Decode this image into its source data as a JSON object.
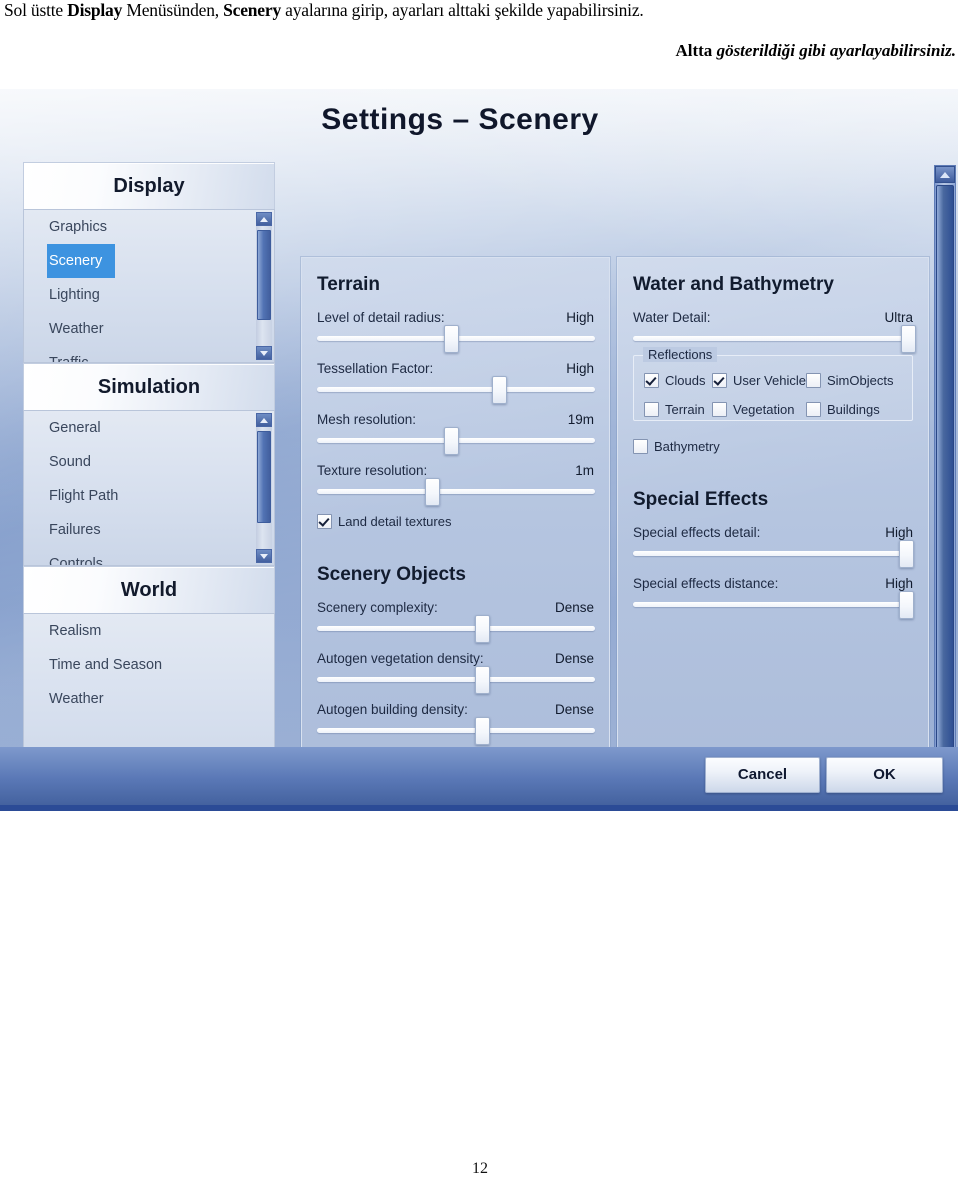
{
  "document": {
    "line1_pre": "Sol üstte ",
    "line1_b1": "Display",
    "line1_mid": " Menüsünden, ",
    "line1_b2": "Scenery",
    "line1_post": " ayalarına girip, ayarları alttaki şekilde yapabilirsiniz.",
    "line2_bold": "Altta ",
    "line2_bolditalic": "gösterildiği gibi ayarlayabilirsiniz.",
    "page_number": "12"
  },
  "dialog": {
    "title": "Settings – Scenery",
    "accent_color": "#3d93e0",
    "footer": {
      "cancel_label": "Cancel",
      "ok_label": "OK"
    }
  },
  "nav": {
    "groups": [
      {
        "header": "Display",
        "items": [
          "Graphics",
          "Scenery",
          "Lighting",
          "Weather",
          "Traffic"
        ],
        "selected": "Scenery",
        "scrollbar": true
      },
      {
        "header": "Simulation",
        "items": [
          "General",
          "Sound",
          "Flight Path",
          "Failures",
          "Controls"
        ],
        "selected": null,
        "scrollbar": true
      },
      {
        "header": "World",
        "items": [
          "Realism",
          "Time and Season",
          "Weather"
        ],
        "selected": null,
        "scrollbar": false
      }
    ]
  },
  "center_panel": {
    "groups": [
      {
        "title": "Terrain",
        "sliders": [
          {
            "label": "Level of detail radius:",
            "value": "High",
            "position_pct": 48
          },
          {
            "label": "Tessellation Factor:",
            "value": "High",
            "position_pct": 65
          },
          {
            "label": "Mesh resolution:",
            "value": "19m",
            "position_pct": 48
          },
          {
            "label": "Texture resolution:",
            "value": "1m",
            "position_pct": 41
          }
        ],
        "checkboxes": [
          {
            "label": "Land detail textures",
            "checked": true
          }
        ]
      },
      {
        "title": "Scenery Objects",
        "sliders": [
          {
            "label": "Scenery complexity:",
            "value": "Dense",
            "position_pct": 59
          },
          {
            "label": "Autogen vegetation density:",
            "value": "Dense",
            "position_pct": 59
          },
          {
            "label": "Autogen building density:",
            "value": "Dense",
            "position_pct": 59
          }
        ],
        "checkboxes": []
      }
    ]
  },
  "right_panel": {
    "groups": [
      {
        "title": "Water and Bathymetry",
        "sliders": [
          {
            "label": "Water Detail:",
            "value": "Ultra",
            "position_pct": 98
          }
        ],
        "fieldset": {
          "legend": "Reflections",
          "checkboxes": [
            {
              "label": "Clouds",
              "checked": true
            },
            {
              "label": "User Vehicle",
              "checked": true
            },
            {
              "label": "SimObjects",
              "checked": false
            },
            {
              "label": "Terrain",
              "checked": false
            },
            {
              "label": "Vegetation",
              "checked": false
            },
            {
              "label": "Buildings",
              "checked": false
            }
          ]
        },
        "checkboxes": [
          {
            "label": "Bathymetry",
            "checked": false
          }
        ]
      },
      {
        "title": "Special Effects",
        "sliders": [
          {
            "label": "Special effects detail:",
            "value": "High",
            "position_pct": 97
          },
          {
            "label": "Special effects distance:",
            "value": "High",
            "position_pct": 97
          }
        ],
        "checkboxes": []
      }
    ]
  }
}
